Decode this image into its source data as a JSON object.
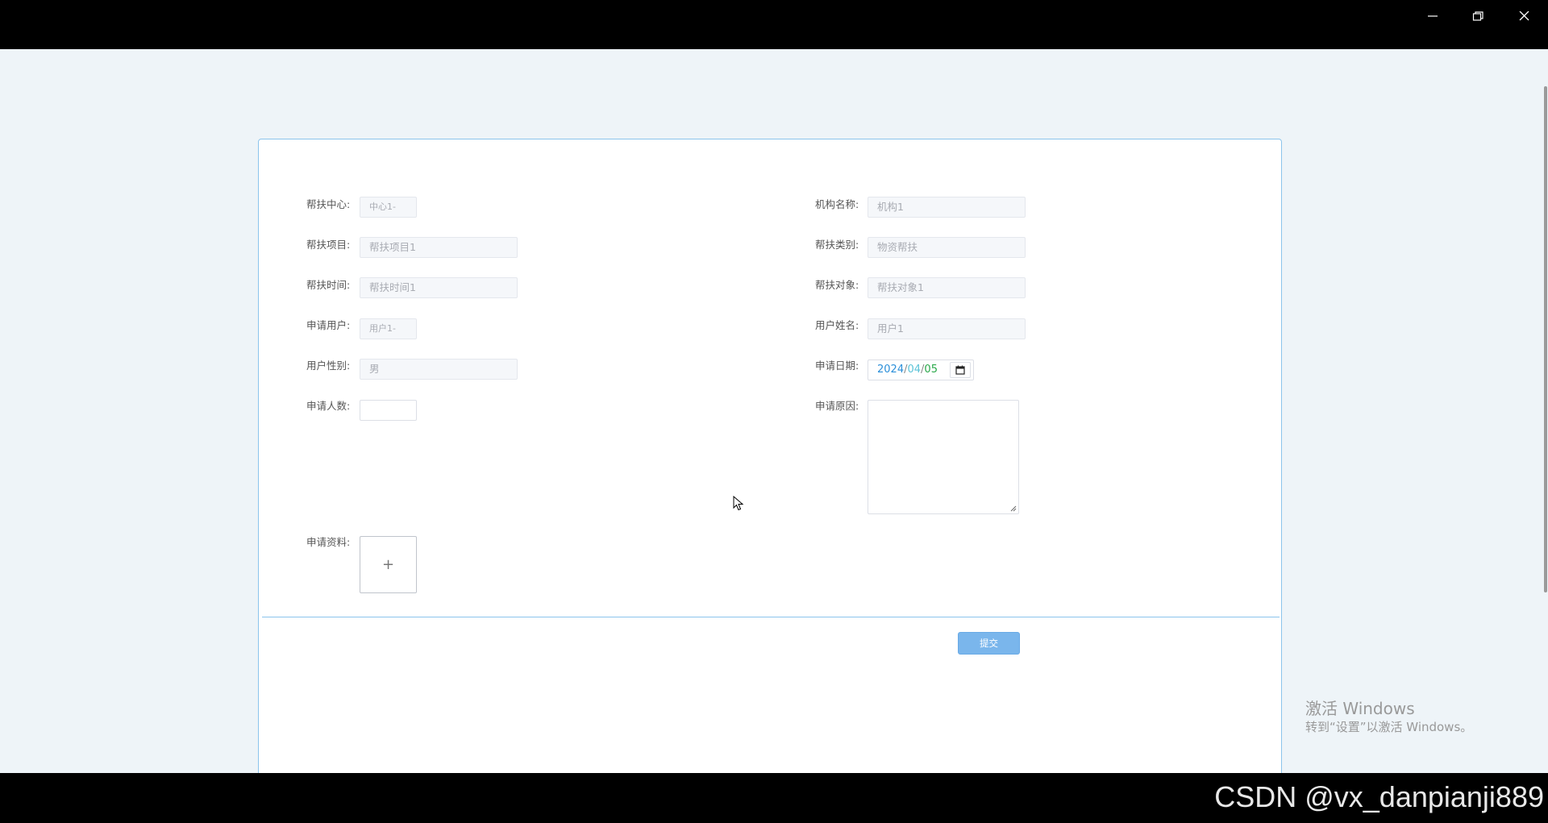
{
  "window": {
    "minimize_icon": "minimize-icon",
    "restore_icon": "restore-icon",
    "close_icon": "close-icon"
  },
  "form": {
    "rows": {
      "center": {
        "label": "帮扶中心:",
        "value": "中心1-"
      },
      "org_name": {
        "label": "机构名称:",
        "value": "机构1"
      },
      "project": {
        "label": "帮扶项目:",
        "value": "帮扶项目1"
      },
      "category": {
        "label": "帮扶类别:",
        "value": "物资帮扶"
      },
      "time": {
        "label": "帮扶时间:",
        "value": "帮扶时间1"
      },
      "target": {
        "label": "帮扶对象:",
        "value": "帮扶对象1"
      },
      "applicant": {
        "label": "申请用户:",
        "value": "用户1-"
      },
      "user_name": {
        "label": "用户姓名:",
        "value": "用户1"
      },
      "gender": {
        "label": "用户性别:",
        "value": "男"
      },
      "apply_date": {
        "label": "申请日期:",
        "year": "2024",
        "month": "04",
        "day": "05",
        "sep": "/"
      },
      "headcount": {
        "label": "申请人数:",
        "value": ""
      },
      "reason": {
        "label": "申请原因:",
        "value": ""
      },
      "materials": {
        "label": "申请资料:",
        "upload_symbol": "+"
      }
    },
    "submit_label": "提交"
  },
  "os": {
    "activate_title": "激活 Windows",
    "activate_sub": "转到“设置”以激活 Windows。"
  },
  "watermark": "CSDN @vx_danpianji889",
  "colors": {
    "panel_border": "#8cc4ec",
    "submit_bg": "#7ab6ec",
    "page_bg": "#eef4f8"
  }
}
